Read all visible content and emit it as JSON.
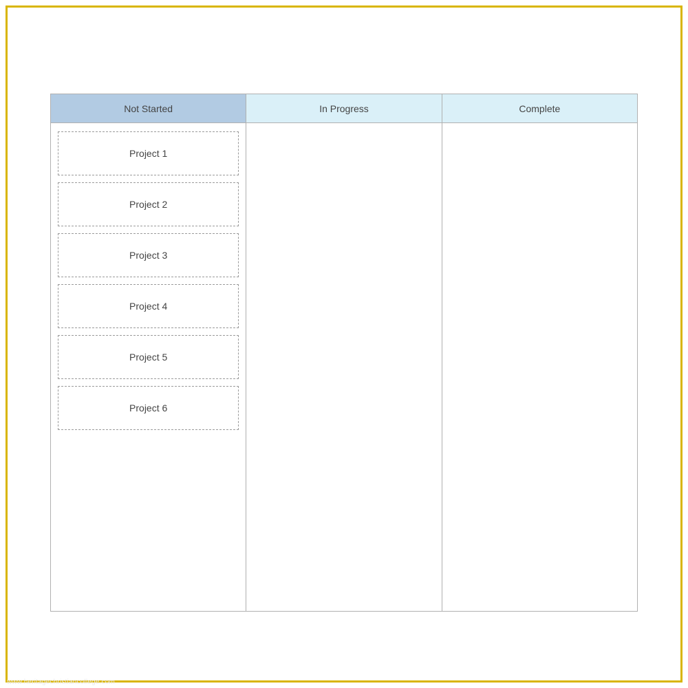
{
  "columns": [
    {
      "title": "Not Started",
      "header_class": "header-not-started",
      "cards": [
        {
          "label": "Project 1"
        },
        {
          "label": "Project 2"
        },
        {
          "label": "Project 3"
        },
        {
          "label": "Project 4"
        },
        {
          "label": "Project 5"
        },
        {
          "label": "Project 6"
        }
      ]
    },
    {
      "title": "In Progress",
      "header_class": "header-in-progress",
      "cards": []
    },
    {
      "title": "Complete",
      "header_class": "header-complete",
      "cards": []
    }
  ],
  "watermark": "www.heritagechristiancollege.com"
}
